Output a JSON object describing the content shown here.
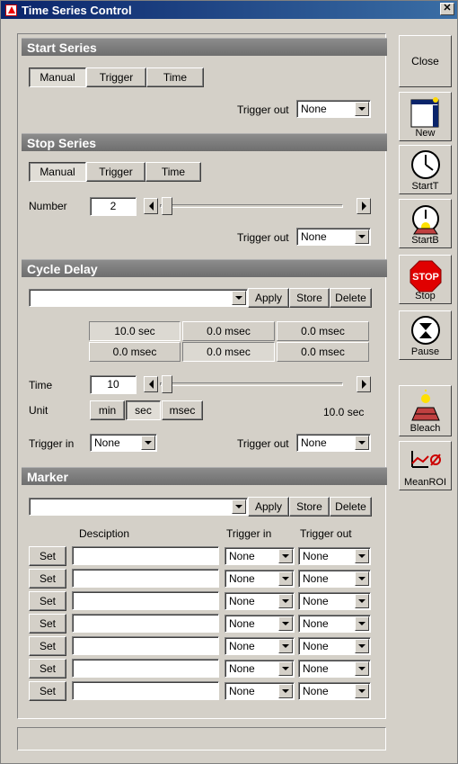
{
  "window": {
    "title": "Time Series Control"
  },
  "start_series": {
    "header": "Start Series",
    "modes": [
      "Manual",
      "Trigger",
      "Time"
    ],
    "active_mode": "Manual",
    "trigger_out_label": "Trigger out",
    "trigger_out_value": "None"
  },
  "stop_series": {
    "header": "Stop Series",
    "modes": [
      "Manual",
      "Trigger",
      "Time"
    ],
    "active_mode": "Manual",
    "number_label": "Number",
    "number_value": "2",
    "trigger_out_label": "Trigger out",
    "trigger_out_value": "None"
  },
  "cycle_delay": {
    "header": "Cycle Delay",
    "preset_value": "",
    "apply_label": "Apply",
    "store_label": "Store",
    "delete_label": "Delete",
    "presets": [
      "10.0 sec",
      "0.0 msec",
      "0.0 msec",
      "0.0 msec",
      "0.0 msec",
      "0.0 msec"
    ],
    "time_label": "Time",
    "time_value": "10",
    "unit_label": "Unit",
    "units": [
      "min",
      "sec",
      "msec"
    ],
    "active_unit": "sec",
    "readout": "10.0 sec",
    "trigger_in_label": "Trigger in",
    "trigger_in_value": "None",
    "trigger_out_label": "Trigger out",
    "trigger_out_value": "None"
  },
  "marker": {
    "header": "Marker",
    "preset_value": "",
    "apply_label": "Apply",
    "store_label": "Store",
    "delete_label": "Delete",
    "columns": {
      "description": "Desciption",
      "trigger_in": "Trigger in",
      "trigger_out": "Trigger out"
    },
    "rows": [
      {
        "set": "Set",
        "description": "",
        "trigger_in": "None",
        "trigger_out": "None"
      },
      {
        "set": "Set",
        "description": "",
        "trigger_in": "None",
        "trigger_out": "None"
      },
      {
        "set": "Set",
        "description": "",
        "trigger_in": "None",
        "trigger_out": "None"
      },
      {
        "set": "Set",
        "description": "",
        "trigger_in": "None",
        "trigger_out": "None"
      },
      {
        "set": "Set",
        "description": "",
        "trigger_in": "None",
        "trigger_out": "None"
      },
      {
        "set": "Set",
        "description": "",
        "trigger_in": "None",
        "trigger_out": "None"
      },
      {
        "set": "Set",
        "description": "",
        "trigger_in": "None",
        "trigger_out": "None"
      }
    ]
  },
  "sidebar": {
    "close": "Close",
    "new": "New",
    "start_t": "StartT",
    "start_b": "StartB",
    "stop": "Stop",
    "stop_icon_text": "STOP",
    "pause": "Pause",
    "bleach": "Bleach",
    "mean_roi": "MeanROI"
  },
  "status": {
    "text": ""
  }
}
